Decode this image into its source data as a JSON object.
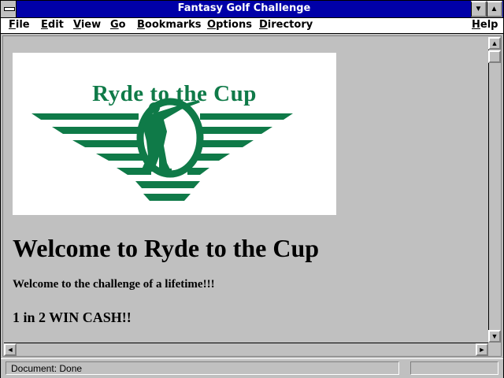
{
  "window": {
    "title": "Fantasy Golf Challenge",
    "minimize_glyph": "▼",
    "maximize_glyph": "▲"
  },
  "menu": {
    "items": [
      "File",
      "Edit",
      "View",
      "Go",
      "Bookmarks",
      "Options",
      "Directory"
    ],
    "help": "Help"
  },
  "page": {
    "logo_text": "Ryde to the Cup",
    "heading": "Welcome to Ryde to the Cup",
    "paragraph1": "Welcome to the challenge of a lifetime!!!",
    "paragraph2": "1 in 2 WIN CASH!!"
  },
  "scrollbar": {
    "up": "▲",
    "down": "▼",
    "left": "◄",
    "right": "►"
  },
  "status": {
    "text": "Document: Done",
    "progress": 0
  },
  "colors": {
    "titlebar": "#0000a8",
    "logo_green": "#0f7a48",
    "chrome": "#c0c0c0"
  }
}
